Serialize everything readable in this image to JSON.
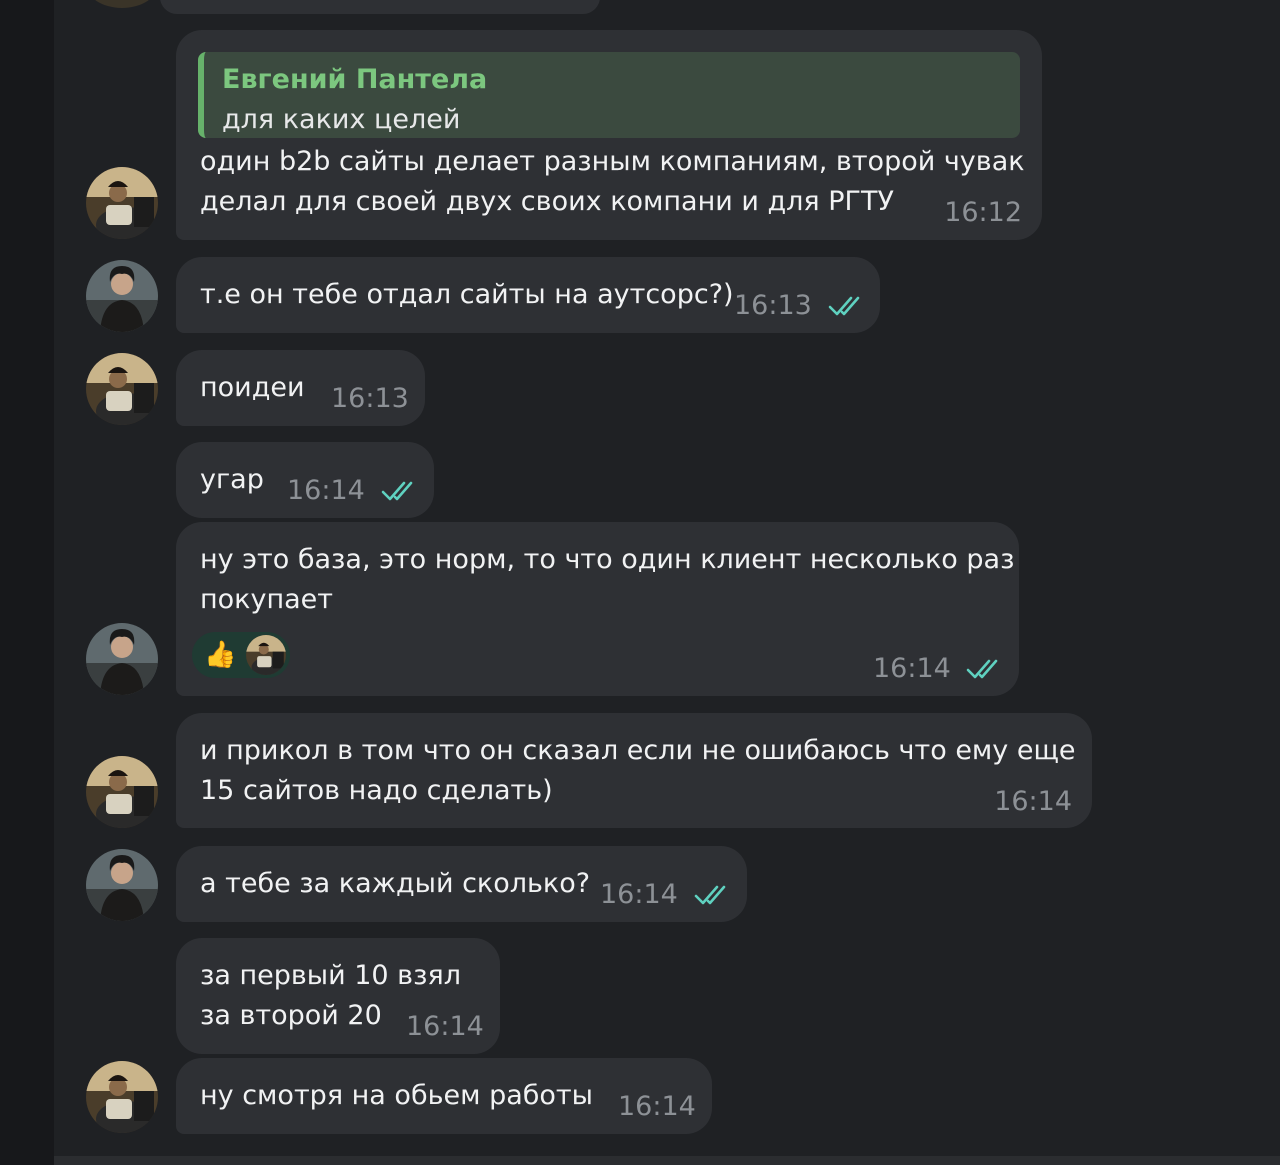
{
  "colors": {
    "background": "#1f2124",
    "bubble": "#2e3034",
    "reply_accent": "#67b26b",
    "read_check": "#5fd1c0",
    "time": "#8d9196"
  },
  "messages": [
    {
      "reply_to": {
        "name": "Евгений Пантела",
        "text": "для каких целей"
      },
      "lines": [
        "один b2b сайты делает разным компаниям, второй чувак",
        "делал для своей двух своих  компани и для РГТУ"
      ],
      "time": "16:12",
      "read": false,
      "avatar": "avatar-user-a"
    },
    {
      "lines": [
        "т.е он тебе отдал сайты на аутсорс?)"
      ],
      "time": "16:13",
      "read": true,
      "avatar": "avatar-user-b"
    },
    {
      "lines": [
        "поидеи"
      ],
      "time": "16:13",
      "read": false,
      "avatar": "avatar-user-a"
    },
    {
      "lines": [
        "угар"
      ],
      "time": "16:14",
      "read": true,
      "avatar": ""
    },
    {
      "lines": [
        "ну это база, это норм, то что один клиент несколько раз",
        "покупает"
      ],
      "reaction": {
        "emoji": "👍",
        "icon": "thumbs-up-icon"
      },
      "time": "16:14",
      "read": true,
      "avatar": "avatar-user-b"
    },
    {
      "lines": [
        "и прикол в том что он сказал если не ошибаюсь что ему еще",
        "15 сайтов надо сделать)"
      ],
      "time": "16:14",
      "read": false,
      "avatar": "avatar-user-a"
    },
    {
      "lines": [
        "а тебе за каждый сколько?"
      ],
      "time": "16:14",
      "read": true,
      "avatar": "avatar-user-b"
    },
    {
      "lines": [
        "за первый 10 взял",
        "за второй 20"
      ],
      "time": "16:14",
      "read": false,
      "avatar": ""
    },
    {
      "lines": [
        "ну смотря на обьем работы"
      ],
      "time": "16:14",
      "read": false,
      "avatar": "avatar-user-a"
    }
  ]
}
